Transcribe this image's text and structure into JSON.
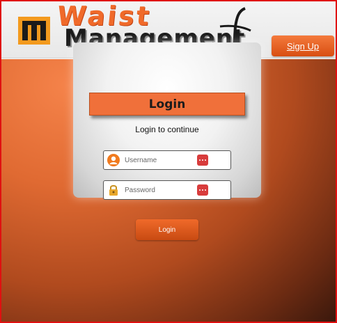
{
  "header": {
    "logo_word_top": "Waist",
    "logo_word_bottom": "Management",
    "signup_label": "Sign Up"
  },
  "login": {
    "title": "Login",
    "subtitle": "Login to continue",
    "username_placeholder": "Username",
    "password_placeholder": "Password",
    "submit_label": "Login"
  },
  "icons": {
    "logo": "waist-management-logo-icon",
    "user": "user-icon",
    "lock": "lock-icon",
    "more": "more-dots-icon"
  },
  "colors": {
    "accent": "#f0703a",
    "accent_dark": "#c84a12",
    "frame_border": "#e01010",
    "field_badge": "#d83c3c"
  }
}
